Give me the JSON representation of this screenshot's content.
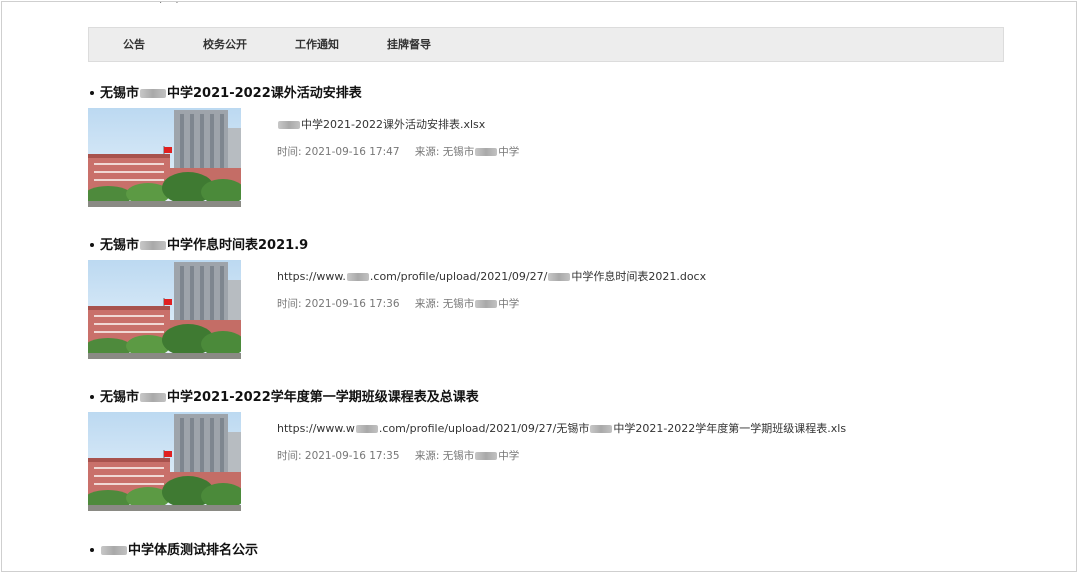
{
  "nav": {
    "items": [
      {
        "label": "公告"
      },
      {
        "label": "校务公开"
      },
      {
        "label": "工作通知"
      },
      {
        "label": "挂牌督导"
      }
    ]
  },
  "articles": [
    {
      "title_prefix": "无锡市",
      "title_suffix": "中学2021-2022课外活动安排表",
      "file_prefix": "",
      "file_suffix": "中学2021-2022课外活动安排表.xlsx",
      "time_label": "时间:",
      "time_value": "2021-09-16 17:47",
      "source_label": "来源:",
      "source_prefix": "无锡市",
      "source_suffix": "中学"
    },
    {
      "title_prefix": "无锡市",
      "title_suffix": "中学作息时间表2021.9",
      "file_prefix": "https://www.",
      "file_suffix": ".com/profile/upload/2021/09/27/",
      "file_suffix2": "中学作息时间表2021.docx",
      "time_label": "时间:",
      "time_value": "2021-09-16 17:36",
      "source_label": "来源:",
      "source_prefix": "无锡市",
      "source_suffix": "中学"
    },
    {
      "title_prefix": "无锡市",
      "title_suffix": "中学2021-2022学年度第一学期班级课程表及总课表",
      "file_prefix": "https://www.w",
      "file_suffix": ".com/profile/upload/2021/09/27/无锡市",
      "file_suffix2": "中学2021-2022学年度第一学期班级课程表.xls",
      "time_label": "时间:",
      "time_value": "2021-09-16 17:35",
      "source_label": "来源:",
      "source_prefix": "无锡市",
      "source_suffix": "中学"
    },
    {
      "title_prefix": "",
      "title_suffix": "中学体质测试排名公示"
    }
  ]
}
